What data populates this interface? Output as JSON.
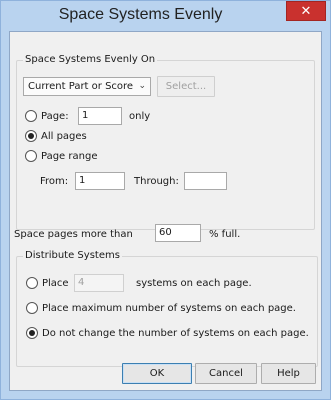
{
  "window": {
    "title": "Space Systems Evenly",
    "close_label": "✕"
  },
  "space_on": {
    "legend": "Space Systems Evenly On",
    "scope_selected": "Current Part or Score",
    "select_button": "Select...",
    "page_label": "Page:",
    "page_value": "1",
    "page_suffix": "only",
    "all_pages_label": "All pages",
    "page_range_label": "Page range",
    "from_label": "From:",
    "from_value": "1",
    "through_label": "Through:",
    "through_value": "",
    "selected_option": "All pages"
  },
  "fullness": {
    "prefix": "Space pages more than",
    "value": "60",
    "suffix": "% full."
  },
  "distribute": {
    "legend": "Distribute Systems",
    "place_label": "Place",
    "place_value": "4",
    "place_suffix": "systems on each page.",
    "max_label": "Place maximum number of systems on each page.",
    "no_change_label": "Do not change the number of systems on each page.",
    "selected_option": "Do not change the number of systems on each page."
  },
  "buttons": {
    "ok": "OK",
    "cancel": "Cancel",
    "help": "Help"
  }
}
